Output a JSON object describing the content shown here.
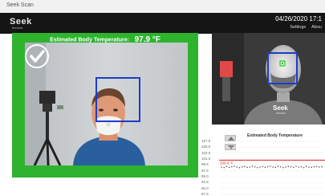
{
  "window": {
    "title": "Seek Scan"
  },
  "header": {
    "logo_text": "Seek",
    "logo_sub": "thermal",
    "datetime": "04/26/2020 17:1",
    "menu": [
      "Settings",
      "Abou"
    ]
  },
  "main": {
    "temperature_label": "Estimated Body Temperature:",
    "temperature_value": "97.9 °F",
    "status": "pass",
    "status_color": "#2fb32f"
  },
  "thermal_view": {
    "logo_text": "Seek",
    "logo_sub": "thermal"
  },
  "chart_data": {
    "type": "line",
    "title": "Estimated Body Temperature",
    "threshold_label": "100.4 °F",
    "threshold": 100.4,
    "threshold_color": "#e02020",
    "series_color": "#555555",
    "yticks": [
      "107.5",
      "105.0",
      "102.5",
      "101.0",
      "99.5",
      "97.5",
      "95.0",
      "92.5",
      "90.0",
      "87.5"
    ],
    "ylim": [
      87.5,
      107.5
    ],
    "values": [
      97.8,
      97.6,
      98.0,
      97.7,
      97.9,
      98.1,
      97.8,
      97.6,
      97.9,
      98.0,
      97.7,
      97.8,
      98.1,
      97.9,
      97.6,
      97.8,
      98.0,
      97.7,
      97.9,
      98.1,
      97.8,
      97.7,
      98.0,
      97.9,
      97.6,
      97.8,
      98.0,
      97.9,
      97.7,
      98.1,
      97.8,
      97.9,
      97.6,
      98.0,
      97.8,
      97.7,
      97.9,
      98.0,
      97.8,
      97.9
    ]
  }
}
